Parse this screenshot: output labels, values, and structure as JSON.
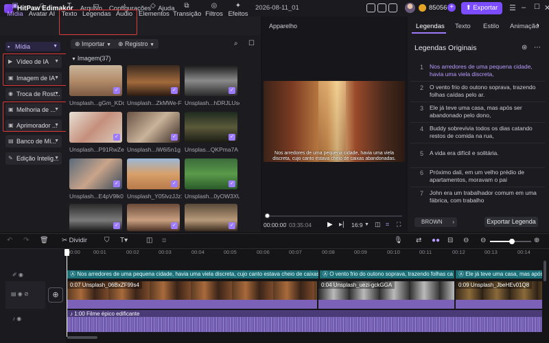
{
  "app": {
    "name": "HitPaw Edimakor",
    "menu": [
      "Arquivo",
      "Configurações",
      "Ajuda"
    ],
    "document": "2026-08-11_01",
    "credits": "85056",
    "export_label": "Exportar"
  },
  "toolbar": [
    {
      "label": "Mídia",
      "icon": "media-icon"
    },
    {
      "label": "Avatar AI",
      "icon": "avatar-icon"
    },
    {
      "label": "Texto",
      "icon": "text-icon"
    },
    {
      "label": "Legendas",
      "icon": "subtitles-icon"
    },
    {
      "label": "Áudio",
      "icon": "audio-icon"
    },
    {
      "label": "Elementos",
      "icon": "elements-icon"
    },
    {
      "label": "Transição",
      "icon": "transition-icon"
    },
    {
      "label": "Filtros",
      "icon": "filters-icon"
    },
    {
      "label": "Efeitos",
      "icon": "effects-icon"
    }
  ],
  "sidebar": {
    "folder": "Mídia",
    "items": [
      "Vídeo de IA",
      "Imagem de IA",
      "Troca de Rost...",
      "Melhoria de ...",
      "Aprimorador ...",
      "Banco de Mí...",
      "Edição Intelig..."
    ]
  },
  "media": {
    "import_label": "Importar",
    "registro_label": "Registro",
    "section_label": "Imagem(37)",
    "items": [
      "Unsplash...gGm_KDco",
      "Unsplash...ZkMWe-Fc",
      "Unsplash...hDRJLUsc",
      "Unsplash...P91RwZeM",
      "Unsplash...iW6i5n1g",
      "Unsplas...QKPma7A",
      "Unsplash...E4pV9lk0",
      "Unsplash_Y05lvzJJz1E",
      "Unsplash...0yOW3XU",
      "",
      "",
      ""
    ]
  },
  "preview": {
    "title": "Apparelho",
    "current_time": "00:00:00",
    "total_time": "03:35:04",
    "ratio": "16:9",
    "overlay_subtitle": "Nos arredores de uma pequena cidade, havia uma viela discreta, cujo canto estava cheio de caixas abandonadas."
  },
  "right_panel": {
    "tabs": [
      "Legendas",
      "Texto",
      "Estilo",
      "Animação"
    ],
    "heading": "Legendas Originais",
    "subtitles": [
      {
        "n": "1",
        "text": "Nos arredores de uma pequena cidade, havia uma viela discreta,"
      },
      {
        "n": "2",
        "text": "O vento frio do outono soprava, trazendo folhas caídas pelo ar."
      },
      {
        "n": "3",
        "text": "Ele já teve uma casa, mas após ser abandonado pelo dono,"
      },
      {
        "n": "4",
        "text": "Buddy sobrevivia todos os dias catando restos de comida na rua,"
      },
      {
        "n": "5",
        "text": "A vida era difícil e solitária."
      },
      {
        "n": "6",
        "text": "Próximo dali, em um velho prédio de apartamentos, moravam o pai"
      },
      {
        "n": "7",
        "text": "John era um trabalhador comum em uma fábrica, com trabalho"
      }
    ],
    "style_label": "BROWN",
    "export_subs_label": "Exportar Legenda"
  },
  "timeline": {
    "split_label": "Dividir",
    "ruler": [
      "00:00",
      "00:01",
      "00:02",
      "00:03",
      "00:04",
      "00:05",
      "00:06",
      "00:07",
      "00:08",
      "00:09",
      "00:10",
      "00:11",
      "00:12",
      "00:13",
      "00:14"
    ],
    "subtitle_clips": [
      "Nos arredores de uma pequena cidade, havia uma viela discreta, cujo canto estava cheio de caixas",
      "O vento frio do outono soprava, trazendo folhas ca",
      "Ele já teve uma casa, mas após"
    ],
    "video_clips": [
      "0:07 Unsplash_06BxZF99s4",
      "0:04 Unsplash_uezi-gckGGA",
      "0:09 Unsplash_JbeHEv01Q8"
    ],
    "audio_clip": "1:00 Filme épico edificante"
  }
}
